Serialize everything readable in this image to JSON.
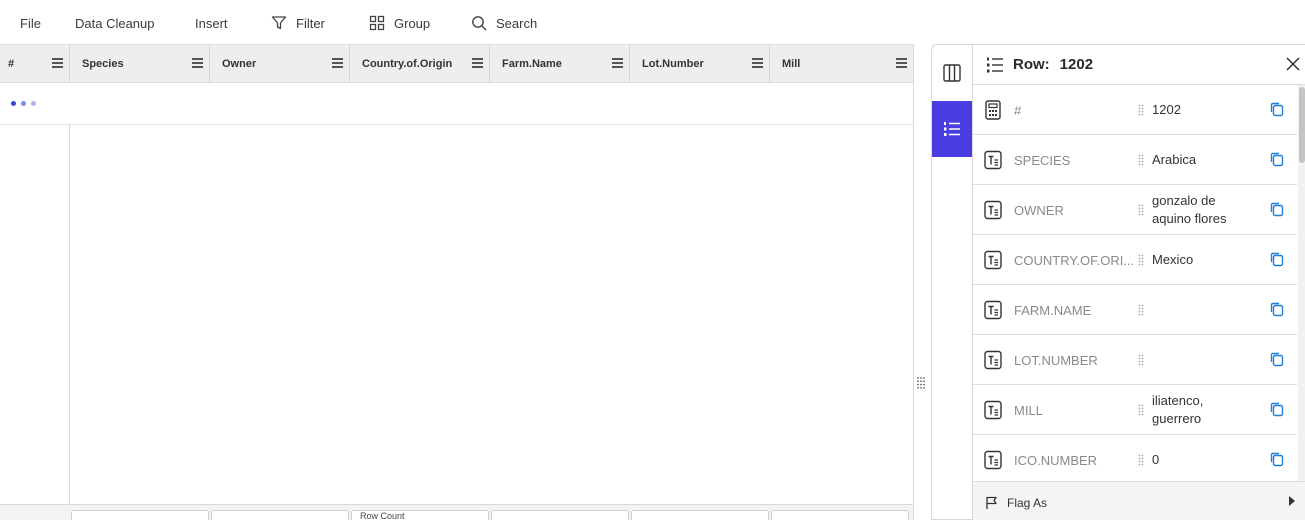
{
  "toolbar": {
    "file": "File",
    "data_cleanup": "Data Cleanup",
    "insert": "Insert",
    "filter": "Filter",
    "group": "Group",
    "search": "Search"
  },
  "grid": {
    "columns": [
      "#",
      "Species",
      "Owner",
      "Country.of.Origin",
      "Farm.Name",
      "Lot.Number",
      "Mill"
    ],
    "loading_dot_colors": [
      "#3a49d6",
      "#7f8fe8",
      "#a9b4f0"
    ],
    "footer": [
      "",
      "",
      "Row Count",
      "",
      "",
      ""
    ]
  },
  "panel": {
    "title_label": "Row:",
    "row_number": "1202",
    "rows": [
      {
        "name": "#",
        "value": "1202",
        "type": "number"
      },
      {
        "name": "SPECIES",
        "value": "Arabica",
        "type": "text"
      },
      {
        "name": "OWNER",
        "value": "gonzalo de aquino flores",
        "type": "text"
      },
      {
        "name": "COUNTRY.OF.ORI...",
        "value": "Mexico",
        "type": "text"
      },
      {
        "name": "FARM.NAME",
        "value": "",
        "type": "text"
      },
      {
        "name": "LOT.NUMBER",
        "value": "",
        "type": "text"
      },
      {
        "name": "MILL",
        "value": "iliatenco, guerrero",
        "type": "text"
      },
      {
        "name": "ICO.NUMBER",
        "value": "0",
        "type": "text"
      }
    ],
    "flag_label": "Flag As"
  },
  "colors": {
    "accent": "#4b3ee0",
    "copy_icon": "#1d7fd6"
  }
}
